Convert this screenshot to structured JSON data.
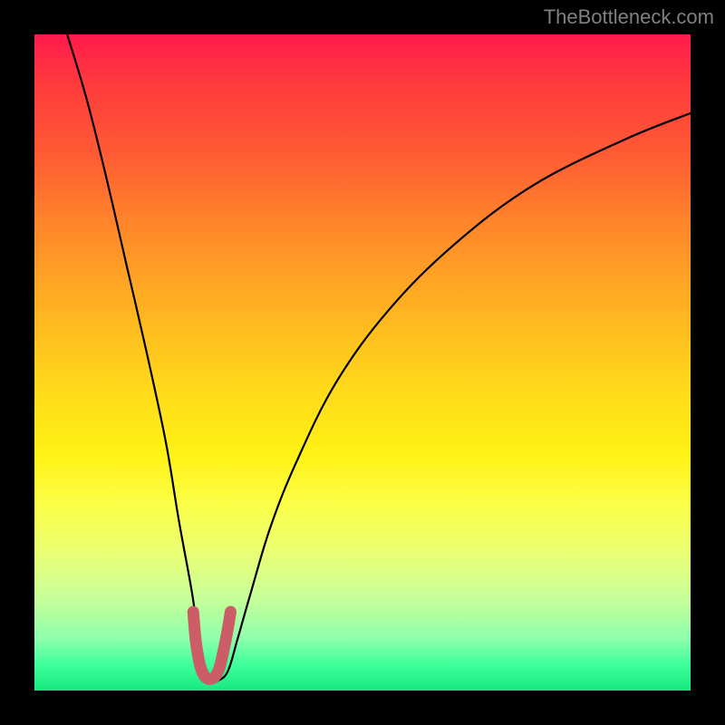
{
  "watermark": "TheBottleneck.com",
  "chart_data": {
    "type": "line",
    "title": "",
    "xlabel": "",
    "ylabel": "",
    "xlim": [
      0,
      100
    ],
    "ylim": [
      0,
      100
    ],
    "series": [
      {
        "name": "bottleneck-curve",
        "x": [
          5,
          8,
          11,
          14,
          17,
          20,
          22,
          24,
          25,
          26,
          27,
          28,
          29.5,
          31,
          33,
          36,
          40,
          46,
          54,
          64,
          76,
          90,
          100
        ],
        "y": [
          100,
          90,
          78,
          65,
          52,
          38,
          26,
          15,
          8,
          3,
          1.5,
          1.5,
          3,
          8,
          15,
          25,
          35,
          47,
          58,
          68,
          77,
          84,
          88
        ]
      },
      {
        "name": "optimal-marker",
        "x": [
          24.2,
          24.6,
          25.2,
          25.8,
          26.4,
          27.0,
          27.6,
          28.2,
          28.8,
          29.4,
          29.9
        ],
        "y": [
          12,
          7.5,
          4.0,
          2.4,
          1.8,
          1.8,
          2.2,
          3.5,
          6.0,
          9.0,
          12
        ]
      }
    ],
    "background_gradient": {
      "top": "#ff1a4d",
      "bottom": "#17e880"
    },
    "marker_color": "#cc5c66",
    "curve_color": "#000000"
  }
}
